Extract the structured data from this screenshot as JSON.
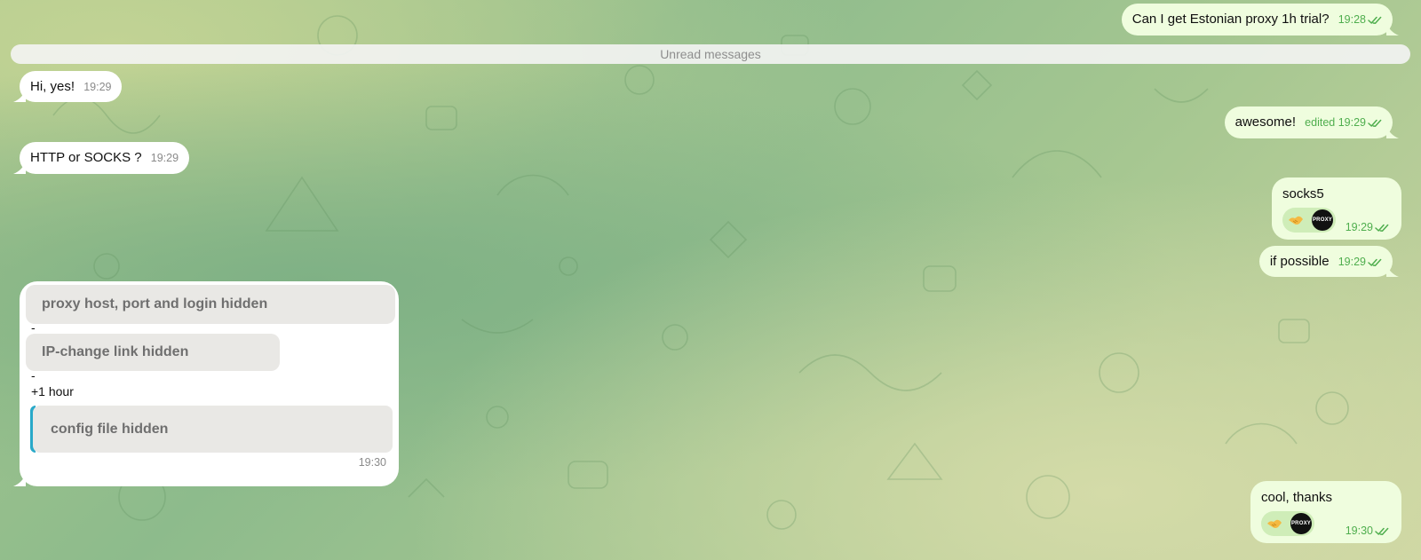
{
  "unread_separator": "Unread messages",
  "messages": [
    {
      "text": "Can I get Estonian proxy 1h trial?",
      "time": "19:28"
    },
    {
      "text": "Hi, yes!",
      "time": "19:29"
    },
    {
      "text": "awesome!",
      "edited": "edited",
      "time": "19:29"
    },
    {
      "text": "HTTP or SOCKS ?",
      "time": "19:29"
    },
    {
      "text": "socks5",
      "time": "19:29",
      "reaction_avatar": "PROXY"
    },
    {
      "text": "if possible",
      "time": "19:29"
    },
    {
      "blocks": [
        "proxy host, port and login hidden",
        "IP-change link hidden",
        "config file hidden"
      ],
      "dash1": "-",
      "dash2": "-",
      "duration": "+1 hour",
      "time": "19:30"
    },
    {
      "text": "cool, thanks",
      "time": "19:30",
      "reaction_avatar": "PROXY"
    }
  ],
  "colors": {
    "incoming_bubble": "#ffffff",
    "outgoing_bubble": "#effdde",
    "outgoing_meta": "#4fae4e",
    "incoming_meta": "#8a8a8a",
    "hidden_block": "#e9e8e5",
    "quote_accent": "#29a9c9"
  },
  "icons": {
    "read_status": "double-check-icon",
    "reaction_emoji": "handshake-icon"
  }
}
